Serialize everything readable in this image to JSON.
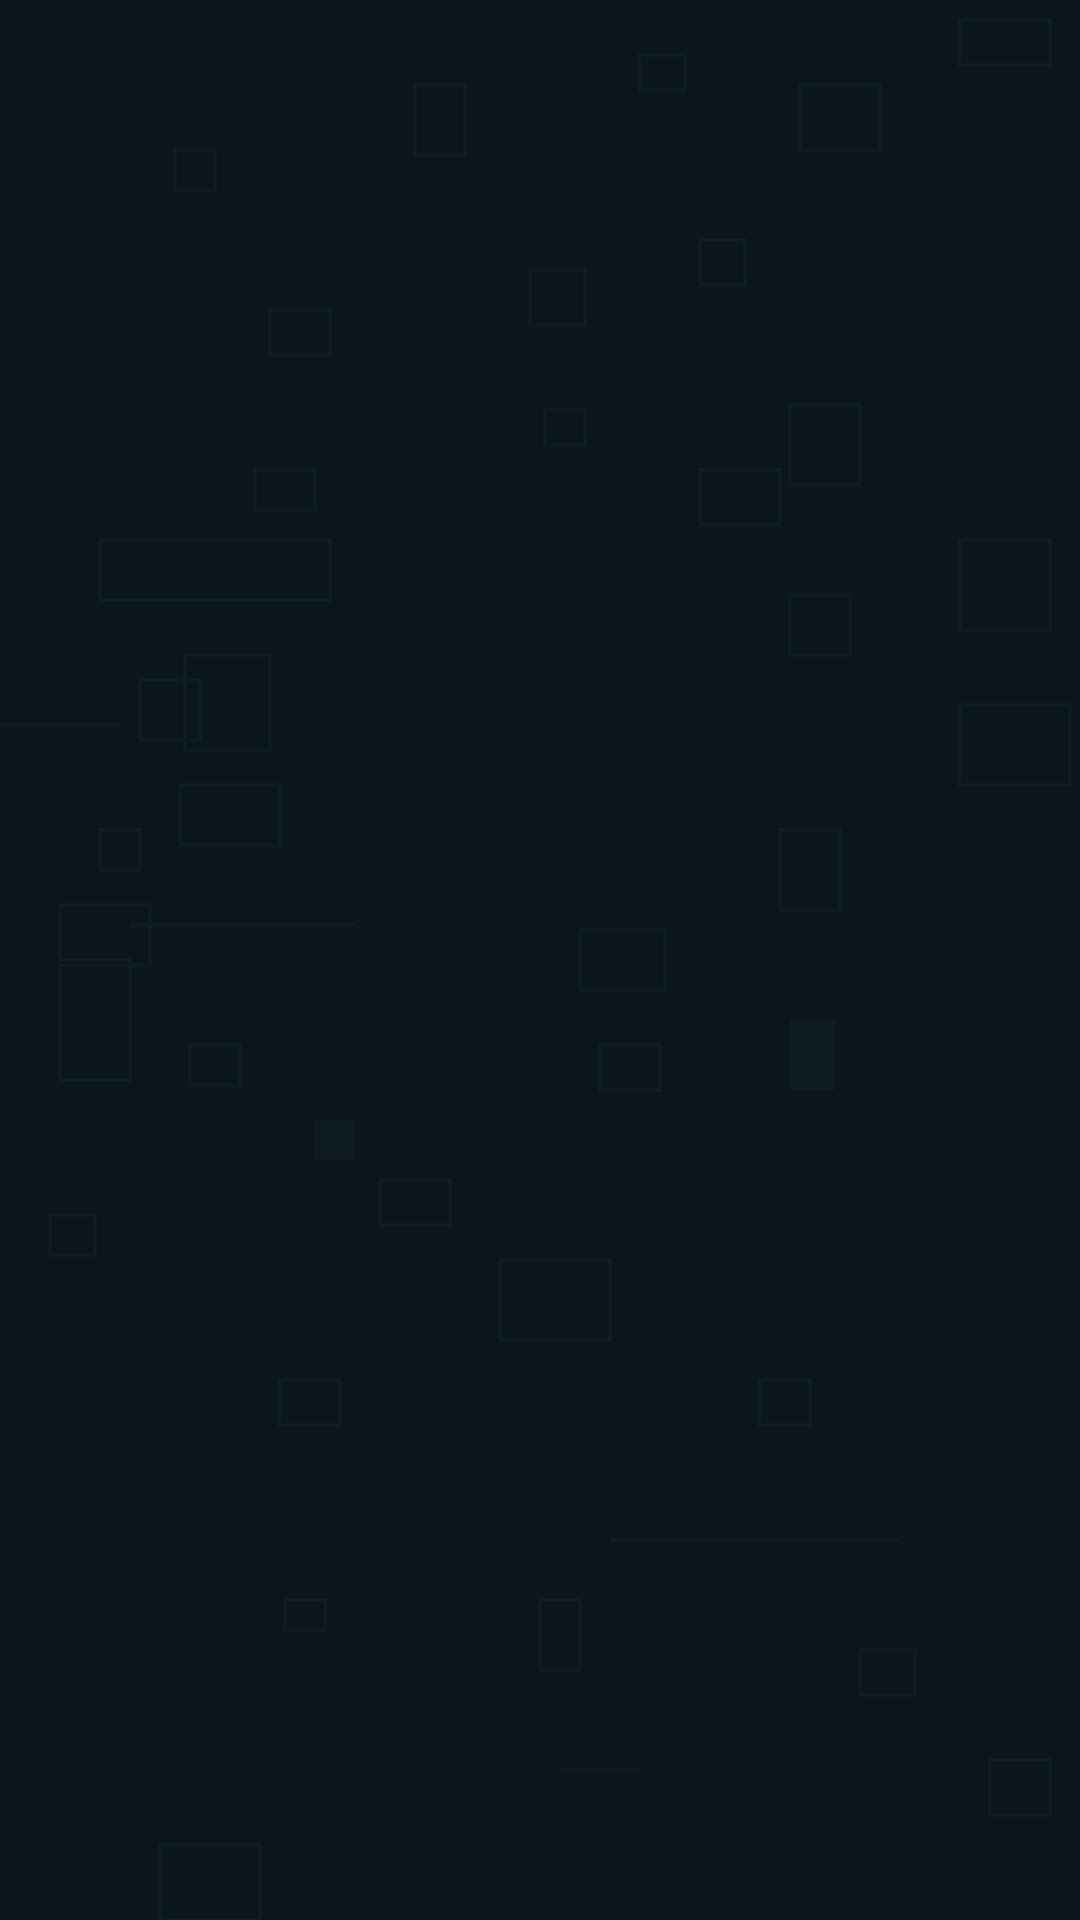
{
  "screen": {
    "background": "#0b161c",
    "texture_color": "#101d24",
    "state": "blank dark screen, no visible text or controls"
  }
}
